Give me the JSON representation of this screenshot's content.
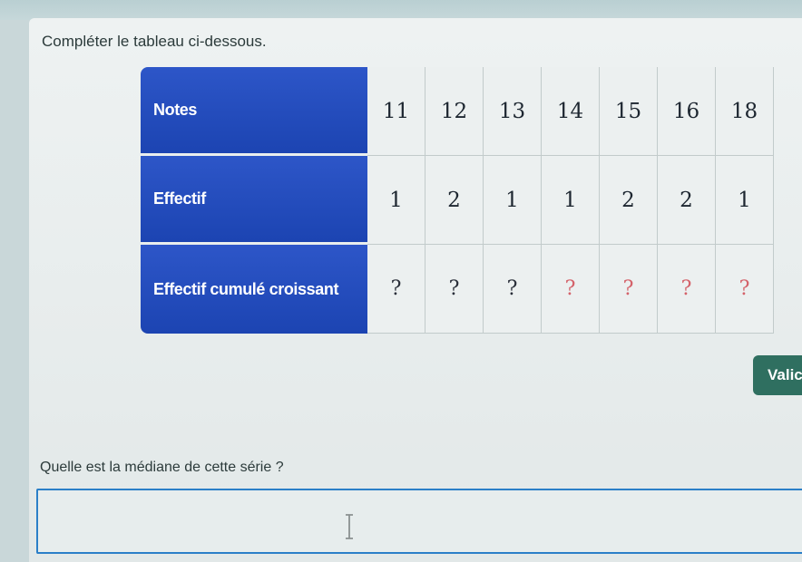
{
  "instruction": "Compléter le tableau ci-dessous.",
  "table": {
    "row_headers": [
      "Notes",
      "Effectif",
      "Effectif cumulé croissant"
    ],
    "notes": [
      "11",
      "12",
      "13",
      "14",
      "15",
      "16",
      "18"
    ],
    "effectifs": [
      "1",
      "2",
      "1",
      "1",
      "2",
      "2",
      "1"
    ],
    "cumules": [
      "?",
      "?",
      "?",
      "?",
      "?",
      "?",
      "?"
    ]
  },
  "valid_button_label": "Valic",
  "question": "Quelle est la médiane de cette série ?",
  "answer": {
    "value": "",
    "placeholder": ""
  },
  "colors": {
    "header_blue": "#1c44b2",
    "button_green": "#2f6f60",
    "input_border": "#2b7fc8",
    "pending_mark": "#d4626a"
  }
}
